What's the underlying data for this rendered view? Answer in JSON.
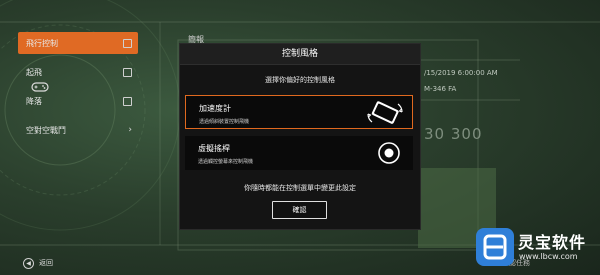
{
  "menu": {
    "items": [
      {
        "label": "飛行控制",
        "control": "checkbox",
        "active": true
      },
      {
        "label": "起飛",
        "control": "checkbox",
        "active": false
      },
      {
        "label": "降落",
        "control": "checkbox",
        "active": false
      },
      {
        "label": "空對空戰鬥",
        "control": "chevron",
        "active": false
      }
    ]
  },
  "background": {
    "summary_label": "簡報",
    "date_fragment": "/15/2019 6:00:00 AM",
    "code_fragment": "M-346 FA",
    "number_fragment": "30 300"
  },
  "modal": {
    "title": "控制風格",
    "subtitle": "選擇你偏好的控制風格",
    "options": [
      {
        "title": "加速度計",
        "desc": "透過傾斜裝置控制飛機",
        "icon": "device-tilt-icon",
        "selected": true
      },
      {
        "title": "虛擬搖桿",
        "desc": "透過觸控螢幕來控制飛機",
        "icon": "joystick-icon",
        "selected": false
      }
    ],
    "footer_note": "你隨時都能在控制選單中變更此設定",
    "confirm_label": "確認"
  },
  "bottom": {
    "back_label": "返回",
    "confirm_label": "確認任務"
  },
  "watermark": {
    "logo_letter": "B",
    "text": "灵宝软件",
    "url": "www.lbcw.com"
  },
  "colors": {
    "accent": "#e06a24",
    "modal_bg": "#141414",
    "option_bg": "#0a0a0a"
  }
}
